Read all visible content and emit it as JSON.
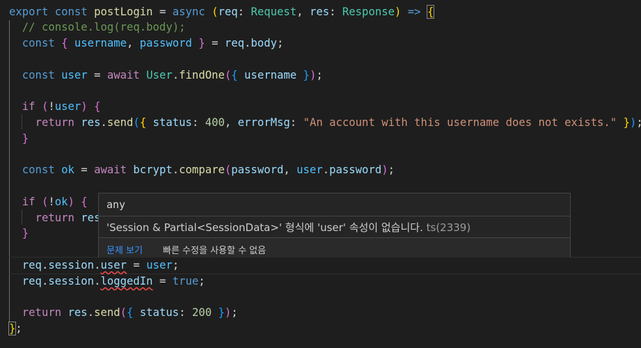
{
  "editor": {
    "language": "typescript",
    "theme": "dark"
  },
  "hover": {
    "signature": "any",
    "message": "'Session & Partial<SessionData>' 형식에 'user' 속성이 없습니다.",
    "error_code": "ts(2339)",
    "view_problem": "문제 보기",
    "no_quick_fix": "빠른 수정을 사용할 수 없음"
  }
}
